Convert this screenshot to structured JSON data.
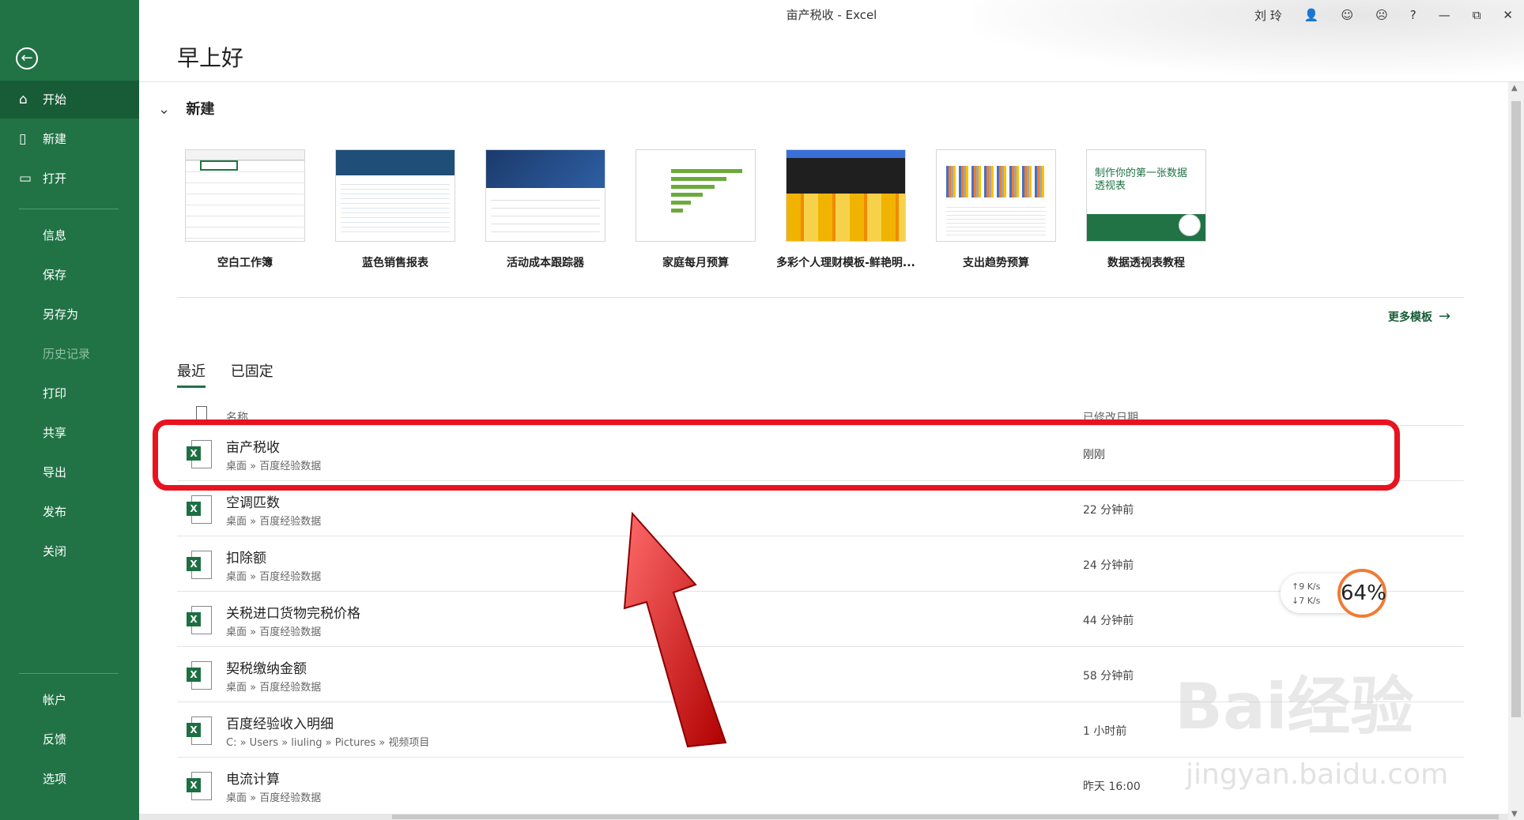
{
  "window": {
    "title": "亩产税收 - Excel",
    "user": "刘 玲",
    "buttons": {
      "help": "?",
      "minimize": "—",
      "restore": "⧉",
      "close": "✕"
    }
  },
  "sidebar": {
    "items": [
      {
        "label": "开始",
        "icon": "home-icon"
      },
      {
        "label": "新建",
        "icon": "new-file-icon"
      },
      {
        "label": "打开",
        "icon": "folder-open-icon"
      },
      {
        "label": "信息"
      },
      {
        "label": "保存"
      },
      {
        "label": "另存为"
      },
      {
        "label": "历史记录"
      },
      {
        "label": "打印"
      },
      {
        "label": "共享"
      },
      {
        "label": "导出"
      },
      {
        "label": "发布"
      },
      {
        "label": "关闭"
      },
      {
        "label": "帐户"
      },
      {
        "label": "反馈"
      },
      {
        "label": "选项"
      }
    ]
  },
  "greeting": "早上好",
  "new_section": {
    "title": "新建",
    "templates": [
      {
        "label": "空白工作簿"
      },
      {
        "label": "蓝色销售报表"
      },
      {
        "label": "活动成本跟踪器"
      },
      {
        "label": "家庭每月预算"
      },
      {
        "label": "多彩个人理财模板-鲜艳明..."
      },
      {
        "label": "支出趋势预算"
      },
      {
        "label": "数据透视表教程"
      }
    ],
    "more": "更多模板",
    "pivot_thumb_text": "制作你的第一张数据透视表"
  },
  "tabs": [
    {
      "label": "最近",
      "active": true
    },
    {
      "label": "已固定",
      "active": false
    }
  ],
  "columns": {
    "name": "名称",
    "modified": "已修改日期"
  },
  "files": [
    {
      "name": "亩产税收",
      "path": "桌面 » 百度经验数据",
      "time": "刚刚"
    },
    {
      "name": "空调匹数",
      "path": "桌面 » 百度经验数据",
      "time": "22 分钟前"
    },
    {
      "name": "扣除额",
      "path": "桌面 » 百度经验数据",
      "time": "24 分钟前"
    },
    {
      "name": "关税进口货物完税价格",
      "path": "桌面 » 百度经验数据",
      "time": "44 分钟前"
    },
    {
      "name": "契税缴纳金额",
      "path": "桌面 » 百度经验数据",
      "time": "58 分钟前"
    },
    {
      "name": "百度经验收入明细",
      "path": "C: » Users » liuling » Pictures » 视频项目",
      "time": "1 小时前"
    },
    {
      "name": "电流计算",
      "path": "桌面 » 百度经验数据",
      "time": "昨天 16:00"
    }
  ],
  "network_widget": {
    "up": "↑9 K/s",
    "down": "↓7 K/s",
    "percent": "64%"
  },
  "watermark": {
    "main": "Bai经验",
    "sub": "jingyan.baidu.com"
  },
  "colors": {
    "sidebar": "#217346",
    "accent": "#185c37",
    "highlight": "#e8131f"
  }
}
